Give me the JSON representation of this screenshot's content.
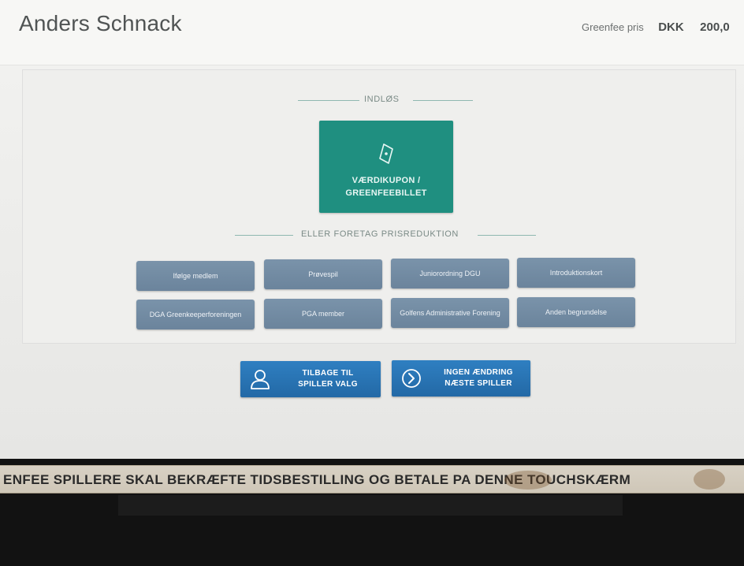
{
  "header": {
    "player_name": "Anders Schnack",
    "price_label": "Greenfee pris",
    "currency": "DKK",
    "amount": "200,0"
  },
  "redeem": {
    "section_label": "INDLØS",
    "voucher_icon": "ticket-icon",
    "voucher_line1": "VÆRDIKUPON /",
    "voucher_line2": "GREENFEEBILLET"
  },
  "reduction": {
    "section_label": "ELLER FORETAG PRISREDUKTION",
    "buttons": [
      {
        "label": "Ifølge medlem"
      },
      {
        "label": "Prøvespil"
      },
      {
        "label": "Juniorordning DGU"
      },
      {
        "label": "Introduktionskort"
      },
      {
        "label": "DGA Greenkeeperforeningen"
      },
      {
        "label": "PGA member"
      },
      {
        "label": "Golfens Administrative Forening"
      },
      {
        "label": "Anden begrundelse"
      }
    ]
  },
  "actions": {
    "back_icon": "user-icon",
    "back_line1": "TILBAGE TIL",
    "back_line2": "SPILLER VALG",
    "next_icon": "chevron-right-circle-icon",
    "next_line1": "INGEN ÆNDRING",
    "next_line2": "NÆSTE SPILLER"
  },
  "sticker": {
    "text": "ENFEE SPILLERE SKAL BEKRÆFTE TIDSBESTILLING OG BETALE PA DENNE TOUCHSKÆRM"
  },
  "colors": {
    "voucher": "#1f8f80",
    "reduction": "#6b849c",
    "action": "#2369a6"
  }
}
